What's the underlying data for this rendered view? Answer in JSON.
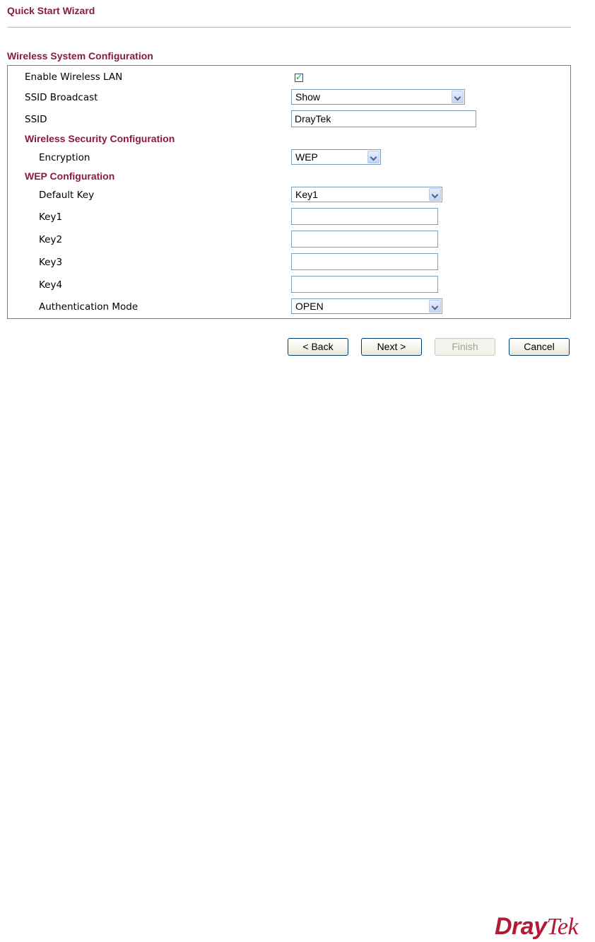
{
  "header": {
    "title": "Quick Start Wizard"
  },
  "section": {
    "title": "Wireless System Configuration"
  },
  "form": {
    "enable_wlan": {
      "label": "Enable Wireless LAN",
      "checked": true
    },
    "ssid_broadcast": {
      "label": "SSID Broadcast",
      "value": "Show"
    },
    "ssid": {
      "label": "SSID",
      "value": "DrayTek"
    },
    "security_heading": "Wireless Security Configuration",
    "encryption": {
      "label": "Encryption",
      "value": "WEP"
    },
    "wep_heading": "WEP Configuration",
    "default_key": {
      "label": "Default Key",
      "value": "Key1"
    },
    "key1": {
      "label": "Key1",
      "value": ""
    },
    "key2": {
      "label": "Key2",
      "value": ""
    },
    "key3": {
      "label": "Key3",
      "value": ""
    },
    "key4": {
      "label": "Key4",
      "value": ""
    },
    "auth_mode": {
      "label": "Authentication Mode",
      "value": "OPEN"
    }
  },
  "buttons": {
    "back": "< Back",
    "next": "Next >",
    "finish": "Finish",
    "cancel": "Cancel"
  },
  "logo": {
    "bold": "Dray",
    "rest": "Tek"
  },
  "colors": {
    "heading": "#8b1a3e",
    "logo": "#b31b34"
  }
}
